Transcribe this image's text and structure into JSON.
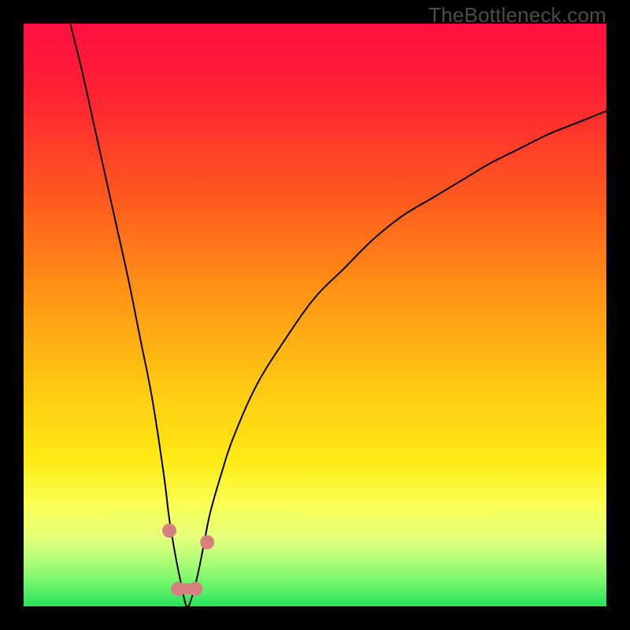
{
  "watermark": "TheBottleneck.com",
  "colors": {
    "black": "#000000",
    "red_top": "#FF1040",
    "red_mid": "#FF3028",
    "orange": "#FF7A16",
    "yellow": "#FFEB14",
    "yellow_pale": "#FBFF6A",
    "green_pale": "#C8FF7A",
    "green": "#27E35E",
    "curve_stroke": "#000000",
    "marker_fill": "#D78080",
    "marker_stroke": "#B05858",
    "watermark_color": "#4c4c4c"
  },
  "gradient_stops": [
    {
      "pos": 0.0,
      "color": "#FF1040"
    },
    {
      "pos": 0.12,
      "color": "#FF2232"
    },
    {
      "pos": 0.3,
      "color": "#FF5A1E"
    },
    {
      "pos": 0.48,
      "color": "#FF9A14"
    },
    {
      "pos": 0.62,
      "color": "#FFC812"
    },
    {
      "pos": 0.75,
      "color": "#FFEA14"
    },
    {
      "pos": 0.82,
      "color": "#FBFF50"
    },
    {
      "pos": 0.88,
      "color": "#E6FF7A"
    },
    {
      "pos": 0.92,
      "color": "#B4FF78"
    },
    {
      "pos": 0.96,
      "color": "#70F56A"
    },
    {
      "pos": 1.0,
      "color": "#27E35E"
    }
  ],
  "chart_data": {
    "type": "line",
    "title": "",
    "xlabel": "",
    "ylabel": "",
    "xlim": [
      0,
      100
    ],
    "ylim": [
      0,
      100
    ],
    "series": [
      {
        "name": "bottleneck-curve",
        "description": "V/U-shaped bottleneck percentage curve; minimum ≈ (28, 0)",
        "x": [
          8,
          10,
          12,
          14,
          16,
          18,
          20,
          22,
          24,
          25,
          26,
          27,
          28,
          29,
          30,
          31,
          32,
          34,
          36,
          40,
          45,
          50,
          55,
          60,
          65,
          70,
          75,
          80,
          85,
          90,
          95,
          100
        ],
        "y": [
          100,
          92,
          83,
          74,
          65,
          56,
          46,
          36,
          23,
          15,
          9,
          4,
          0,
          2,
          6,
          11,
          16,
          23,
          29,
          38,
          46,
          53,
          58,
          63,
          67,
          70,
          73,
          76,
          78.5,
          81,
          83,
          85
        ]
      }
    ],
    "markers": [
      {
        "name": "left-shoulder",
        "x": 25.0,
        "y": 13,
        "r": 9
      },
      {
        "name": "valley-left",
        "x": 26.5,
        "y": 3,
        "r": 9
      },
      {
        "name": "valley-right",
        "x": 29.5,
        "y": 3,
        "r": 9
      },
      {
        "name": "right-shoulder",
        "x": 31.5,
        "y": 11,
        "r": 9
      }
    ],
    "valley_connector": {
      "from": "valley-left",
      "to": "valley-right"
    }
  }
}
